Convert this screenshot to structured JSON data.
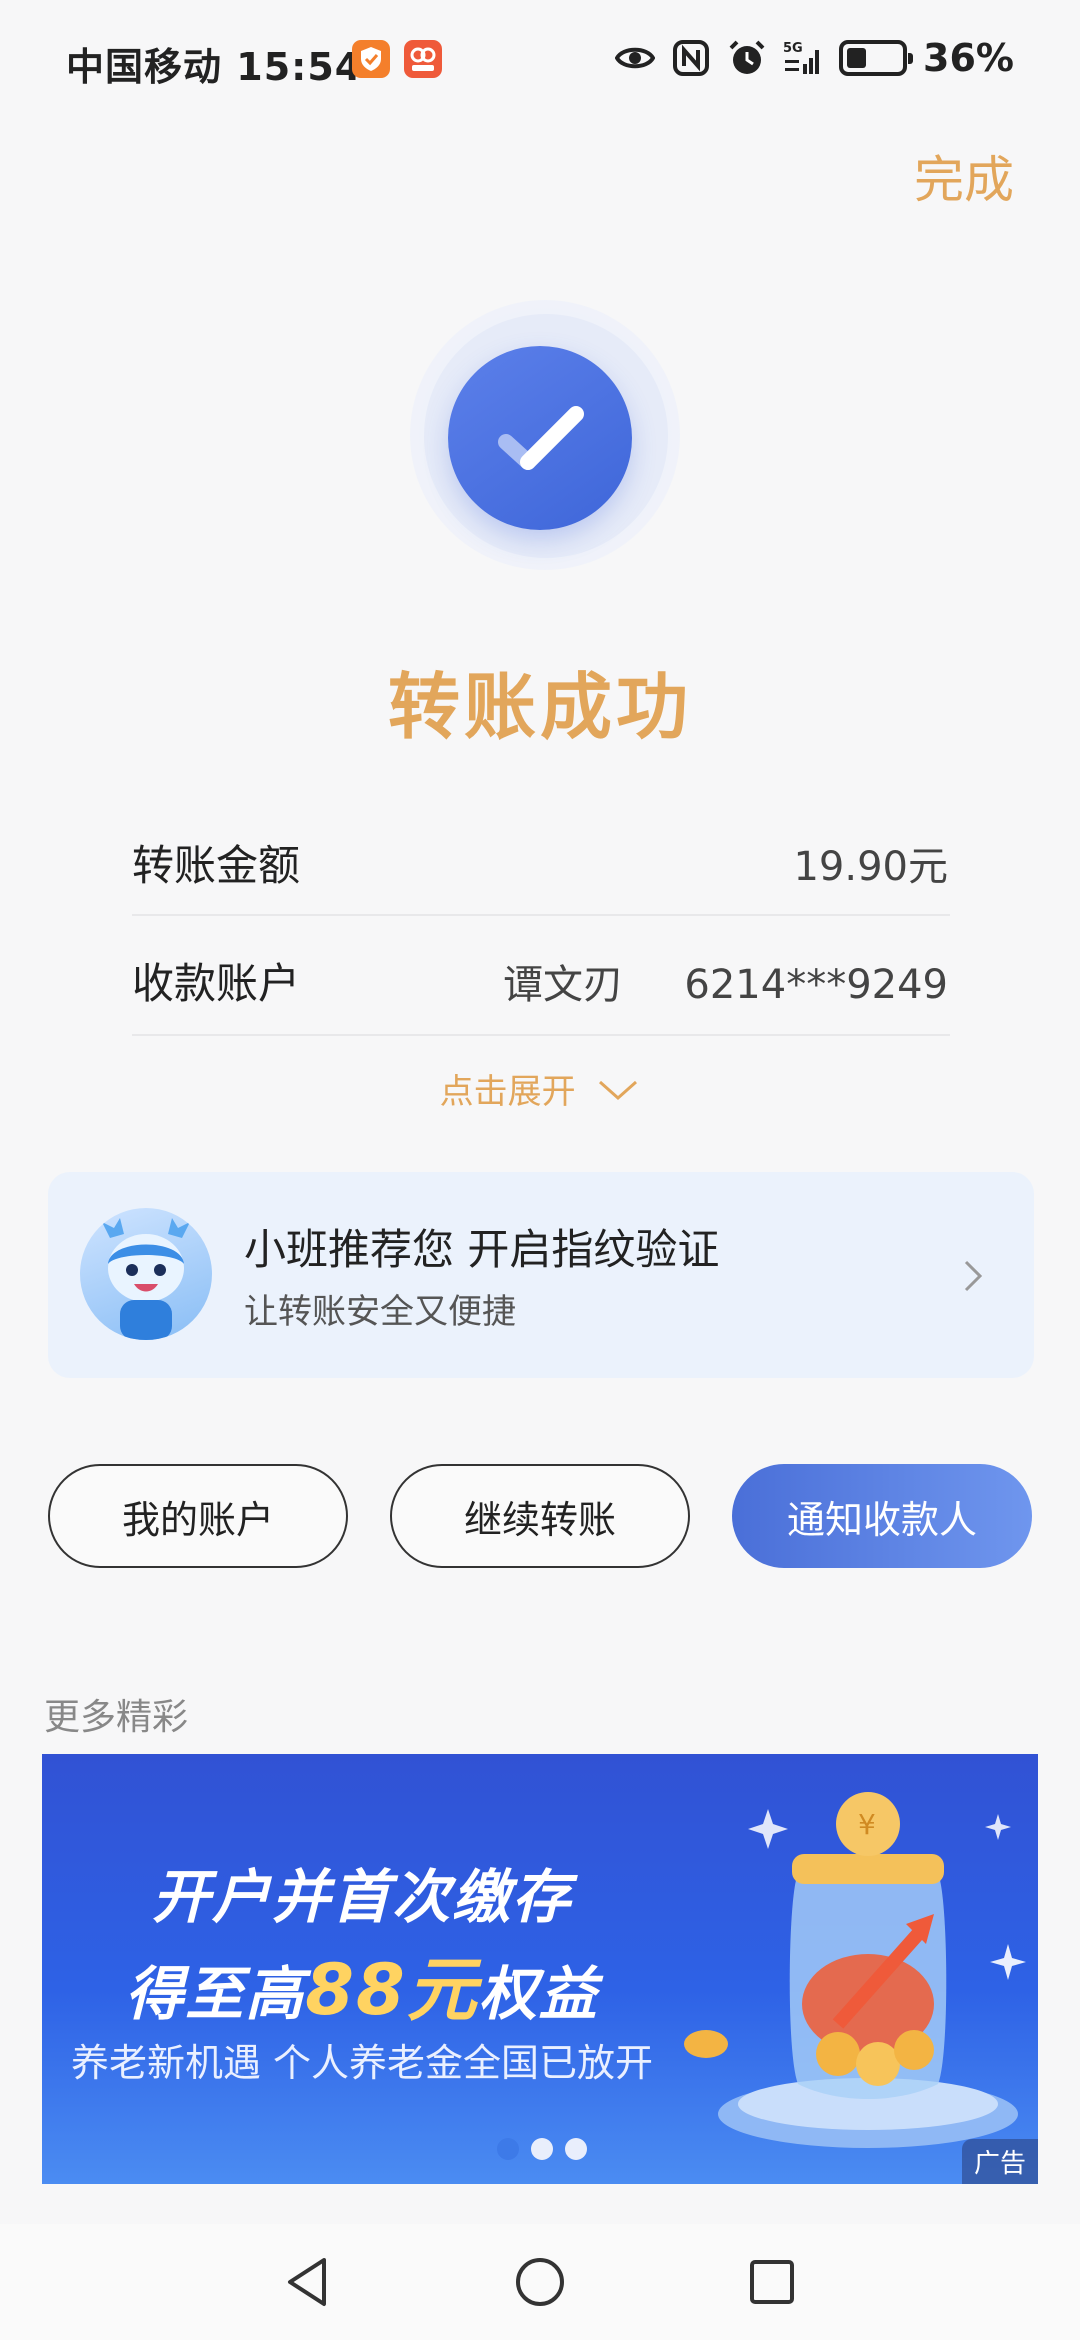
{
  "status_bar": {
    "carrier": "中国移动",
    "time": "15:54",
    "network": "5G",
    "battery_percent": "36%",
    "battery_level": 0.36
  },
  "header": {
    "done_label": "完成"
  },
  "result": {
    "title": "转账成功"
  },
  "details": {
    "amount_label": "转账金额",
    "amount_value": "19.90元",
    "account_label": "收款账户",
    "account_name": "谭文刃",
    "account_number": "6214***9249",
    "expand_label": "点击展开"
  },
  "recommend": {
    "title": "小班推荐您 开启指纹验证",
    "subtitle": "让转账安全又便捷"
  },
  "actions": {
    "my_account": "我的账户",
    "continue_transfer": "继续转账",
    "notify_payee": "通知收款人"
  },
  "more": {
    "label": "更多精彩"
  },
  "banner": {
    "line1": "开户并首次缴存",
    "line2_prefix": "得至高",
    "line2_highlight": "88元",
    "line2_suffix": "权益",
    "line3": "养老新机遇 个人养老金全国已放开",
    "ad_tag": "广告",
    "slide_count": 3,
    "active_slide": 1,
    "coin_symbol": "¥"
  },
  "colors": {
    "accent_gold": "#e2a65b",
    "primary_blue": "#4a6fd8",
    "card_bg": "#ebf2fc"
  }
}
